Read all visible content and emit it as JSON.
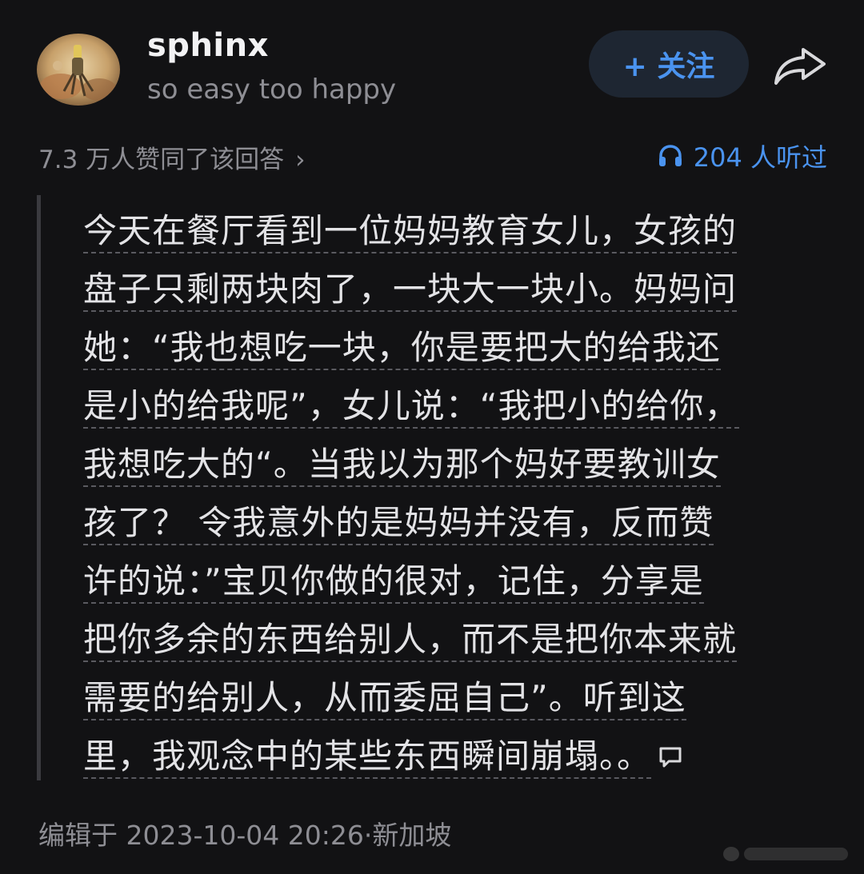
{
  "author": {
    "name": "sphinx",
    "bio": "so easy too happy"
  },
  "follow_button": {
    "label": "+ 关注"
  },
  "stats": {
    "likes": "7.3 万人赞同了该回答",
    "likes_chevron": "›",
    "listens": "204 人听过"
  },
  "answer": {
    "lines": [
      "今天在餐厅看到一位妈妈教育女儿，女孩的",
      "盘子只剩两块肉了，一块大一块小。妈妈问",
      "她：“我也想吃一块，你是要把大的给我还",
      "是小的给我呢”，女儿说：“我把小的给你，",
      "我想吃大的“。当我以为那个妈好要教训女",
      "孩了？ 令我意外的是妈妈并没有，反而赞",
      "许的说：”宝贝你做的很对，记住，分享是",
      "把你多余的东西给别人，而不是把你本来就",
      "需要的给别人，从而委屈自己”。听到这",
      "里，我观念中的某些东西瞬间崩塌。。"
    ]
  },
  "edit_info": "编辑于 2023-10-04 20:26·新加坡",
  "colors": {
    "background": "#121214",
    "accent": "#4a93ef",
    "follow_bg": "#1e2632",
    "muted_text": "#8e8e94"
  },
  "icons": {
    "share": "share-arrow-icon",
    "headphones": "headphones-icon",
    "comment": "comment-bubble-icon"
  }
}
